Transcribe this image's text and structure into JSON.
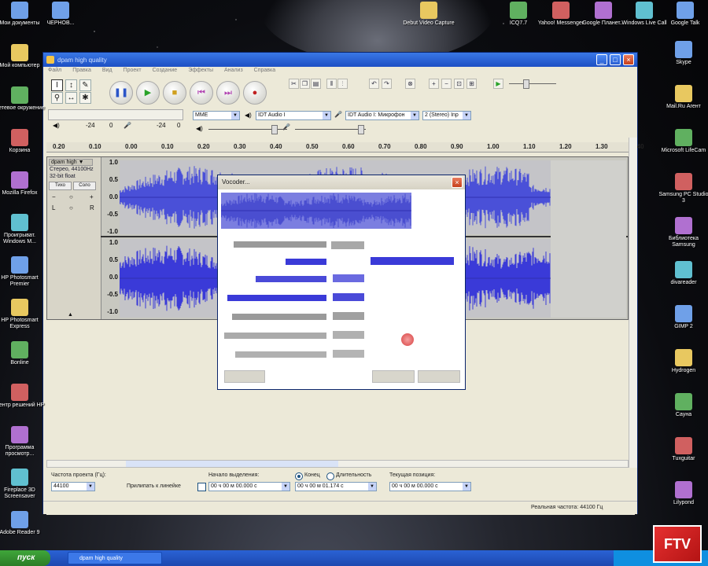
{
  "window": {
    "title": "dpam high quality"
  },
  "menu": [
    "Файл",
    "Правка",
    "Вид",
    "Проект",
    "Создание",
    "Эффекты",
    "Анализ",
    "Справка"
  ],
  "devices": {
    "host": "MME",
    "output": "IDT Audio I",
    "input": "IDT Audio I: Микрофон",
    "channels": "2 (Stereo) Inp"
  },
  "meter_labels": {
    "left": "-24",
    "right": "-24",
    "zero_l": "0",
    "zero_r": "0"
  },
  "ruler": [
    "0.20",
    "0.10",
    "0.00",
    "0.10",
    "0.20",
    "0.30",
    "0.40",
    "0.50",
    "0.60",
    "0.70",
    "0.80",
    "0.90",
    "1.00",
    "1.10",
    "1.20",
    "1.30",
    "1.40"
  ],
  "track": {
    "name": "dpam high",
    "info1": "Стерео, 44100Hz",
    "info2": "32-bit float",
    "mute": "Тихо",
    "solo": "Соло",
    "scale_top": [
      "1.0",
      "0.5",
      "0.0",
      "-0.5",
      "-1.0"
    ],
    "scale_bottom": [
      "1.0",
      "0.5",
      "0.0",
      "-0.5",
      "-1.0"
    ]
  },
  "dialog": {
    "title": "Vocoder..."
  },
  "status": {
    "rate_label": "Частота проекта (Гц):",
    "rate_value": "44100",
    "snap_label": "Прилипать к линейке",
    "sel_start_label": "Начало выделения:",
    "end_label": "Конец",
    "length_label": "Длительность",
    "position_label": "Текущая позиция:",
    "time1": "00 ч 00 м 00.000 с",
    "time2": "00 ч 00 м 01.174 с",
    "time3": "00 ч 00 м 00.000 с",
    "real_rate": "Реальная частота: 44100 Гц"
  },
  "desktop_left": [
    {
      "label": "Мои документы"
    },
    {
      "label": "Мой компьютер"
    },
    {
      "label": "Сетевое окружение"
    },
    {
      "label": "Корзина"
    },
    {
      "label": "Mozilla Firefox"
    },
    {
      "label": "Проигрыват. Windows M..."
    },
    {
      "label": "HP Photosmart Premier"
    },
    {
      "label": "HP Photosmart Express"
    },
    {
      "label": "Bonline"
    },
    {
      "label": "Центр решений HP"
    },
    {
      "label": "Программа просмотр..."
    },
    {
      "label": "Fireplace 3D Screensaver"
    },
    {
      "label": "Adobe Reader 9"
    }
  ],
  "desktop_top": [
    {
      "label": "ЧЕРНОВ..."
    },
    {
      "label": "Debut Video Capture"
    },
    {
      "label": "ICQ7.7"
    },
    {
      "label": "Yahoo! Messenger"
    },
    {
      "label": "Google Планет..."
    },
    {
      "label": "Windows Live Call"
    },
    {
      "label": "Google Talk"
    }
  ],
  "desktop_right": [
    {
      "label": "Skype"
    },
    {
      "label": "Mail.Ru Агент"
    },
    {
      "label": "Microsoft LifeCam"
    },
    {
      "label": "Samsung PC Studio 3"
    },
    {
      "label": "Библиотека Samsung"
    },
    {
      "label": "divareader"
    },
    {
      "label": "GIMP 2"
    },
    {
      "label": "Hydrogen"
    },
    {
      "label": "Сауна"
    },
    {
      "label": "Tuxguitar"
    },
    {
      "label": "Lilypond"
    }
  ],
  "taskbar": {
    "start": "пуск",
    "item": "dpam high quality"
  },
  "logo_text": "FTV"
}
